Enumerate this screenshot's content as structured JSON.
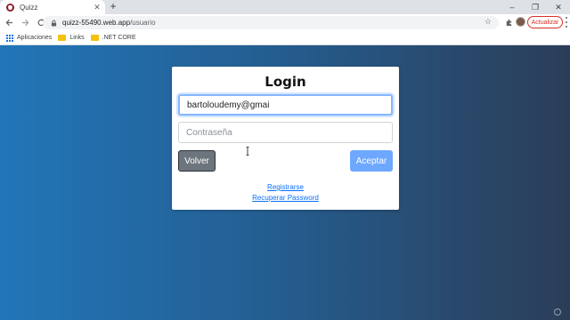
{
  "browser": {
    "tab_title": "Quizz",
    "url_host": "quizz-55490.web.app",
    "url_path": "/usuario",
    "update_label": "Actualizar",
    "bookmarks": [
      "Aplicaciones",
      "Links",
      ".NET CORE"
    ]
  },
  "form": {
    "title": "Login",
    "email_value": "bartoloudemy@gmai",
    "password_placeholder": "Contraseña",
    "back_label": "Volver",
    "accept_label": "Aceptar",
    "register_link": "Registrarse",
    "recover_link": "Recuperar Password"
  },
  "colors": {
    "accent": "#6ea8fe",
    "secondary": "#6c757d",
    "link": "#0d6efd",
    "background_start": "#2176b8",
    "background_end": "#2b3e58"
  },
  "icons": [
    "angular-logo-icon",
    "close-icon",
    "new-tab-icon",
    "minimize-icon",
    "restore-icon",
    "window-close-icon",
    "back-icon",
    "forward-icon",
    "reload-icon",
    "lock-icon",
    "star-icon",
    "extensions-icon",
    "menu-icon",
    "apps-icon",
    "folder-icon"
  ]
}
